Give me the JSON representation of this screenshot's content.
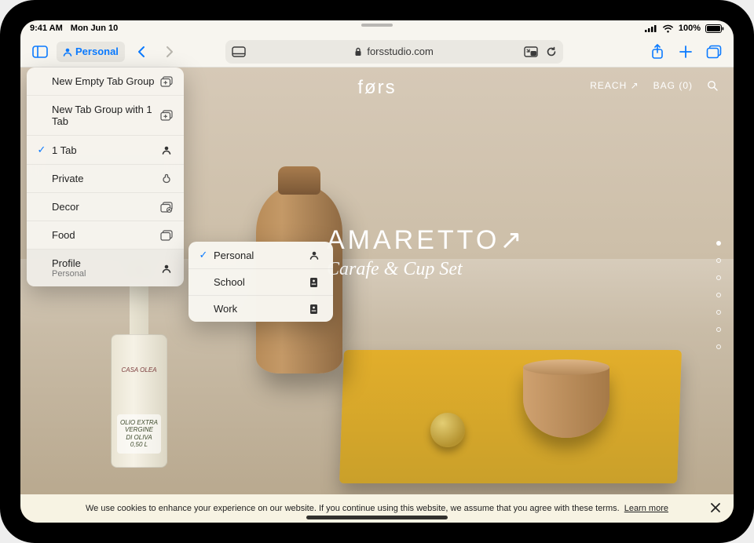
{
  "status": {
    "time": "9:41 AM",
    "date": "Mon Jun 10",
    "battery_pct": "100%"
  },
  "toolbar": {
    "profile_label": "Personal",
    "url": "forsstudio.com"
  },
  "menu": {
    "new_empty": "New Empty Tab Group",
    "new_with_1": "New Tab Group with 1 Tab",
    "one_tab": "1 Tab",
    "private": "Private",
    "decor": "Decor",
    "food": "Food",
    "profile_label": "Profile",
    "profile_current": "Personal"
  },
  "profiles": {
    "p0": "Personal",
    "p1": "School",
    "p2": "Work"
  },
  "site": {
    "logo": "førs",
    "reach": "REACH ↗",
    "bag": "BAG (0)",
    "hero1": "AMARETTO↗",
    "hero2": "Carafe & Cup Set"
  },
  "bottle": {
    "brand": "CASA OLEA",
    "label_line1": "OLIO EXTRA",
    "label_line2": "VERGINE",
    "label_line3": "DI OLIVA",
    "volume": "0,50 L"
  },
  "cookie": {
    "text": "We use cookies to enhance your experience on our website. If you continue using this website, we assume that you agree with these terms.",
    "learn": "Learn more"
  }
}
